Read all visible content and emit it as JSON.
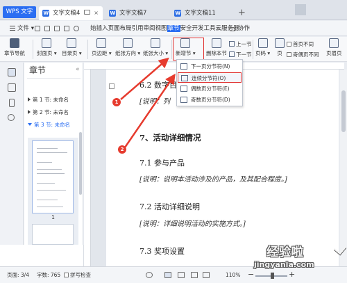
{
  "app": {
    "logo": "WPS 文字"
  },
  "tabs": [
    {
      "label": "文字文稿4",
      "active": true
    },
    {
      "label": "文字文稿7"
    },
    {
      "label": "文字文稿11"
    }
  ],
  "menubar": {
    "file": "文件",
    "ribbon_tabs_before": "始插入页面布局引用审阅视图",
    "ribbon_tabs_active": "章节",
    "ribbon_tabs_after": "安全开发工具云服务器",
    "more": "›",
    "cowork": "协作"
  },
  "ribbon": {
    "chapter_nav": "章节导航",
    "cover": "封面页 ▾",
    "toc": "目录页 ▾",
    "margins": "页边距 ▾",
    "orientation": "纸张方向 ▾",
    "size": "纸张大小 ▾",
    "new_section": "新增节 ▾",
    "delete_section": "删除本节",
    "prev_section": "上一节",
    "next_section": "下一节",
    "page_number": "页码 ▾",
    "page_numbering": "页",
    "first_page_diff": "首页不同",
    "odd_even_diff": "奇偶页不同",
    "header_footer": "页眉页"
  },
  "dropdown": {
    "items": [
      "下一页分节符(N)",
      "连续分节符(O)",
      "偶数页分节符(E)",
      "奇数页分节符(D)"
    ]
  },
  "chapter_panel": {
    "title": "章节",
    "close": "«",
    "items": [
      {
        "label": "第 1 节: 未命名"
      },
      {
        "label": "第 2 节: 未命名"
      },
      {
        "label": "第 3 节: 未命名",
        "active": true
      }
    ],
    "thumb_page": "1"
  },
  "document": {
    "h62": "6.2 数字目标",
    "n62": "[说明：列",
    "h7": "7、活动详细情况",
    "h71": "7.1 参与产品",
    "n71": "[说明：说明本活动涉及的产品，及其配合程度。]",
    "h72": "7.2 活动详细说明",
    "n72": "[说明：详细说明活动的实施方式。]",
    "h73": "7.3 奖项设置"
  },
  "annotations": {
    "badge1": "1",
    "badge2": "2"
  },
  "status": {
    "page": "页面: 3/4",
    "words": "字数: 765",
    "spell": "拼写检查",
    "zoom": "110%",
    "zoom_minus": "−",
    "zoom_plus": "+"
  },
  "watermark": {
    "text": "经验啦",
    "url": "jingyanla.com"
  }
}
